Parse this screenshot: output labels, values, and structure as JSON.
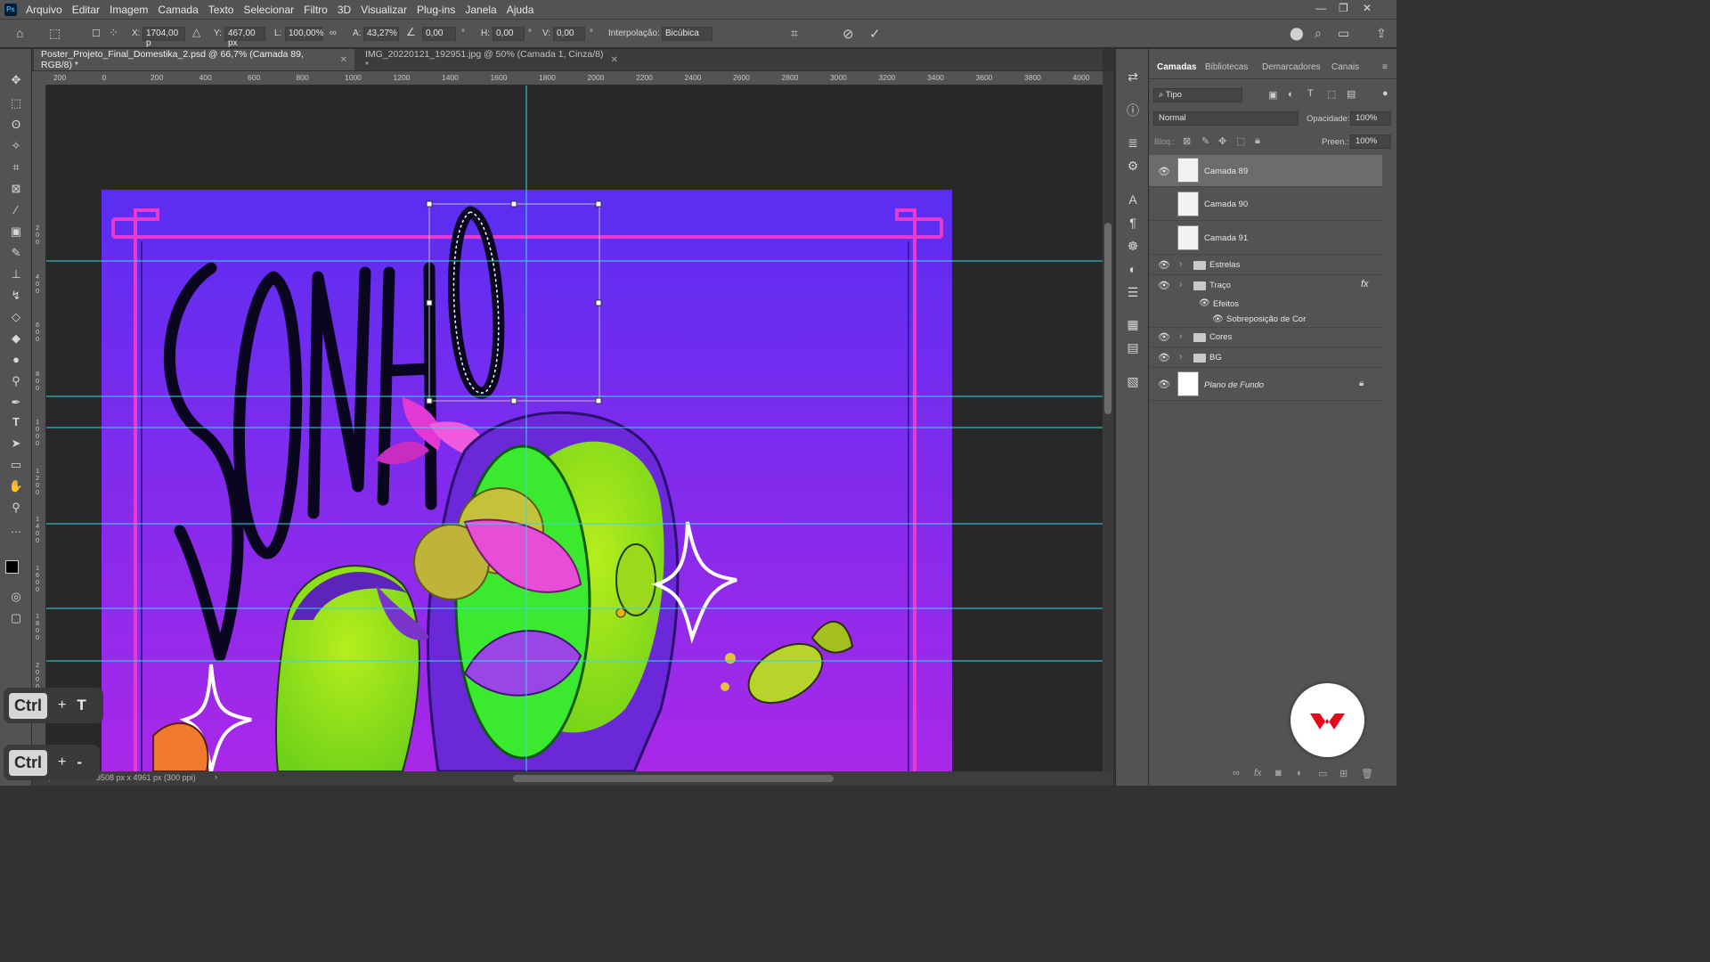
{
  "app": {
    "logo": "Ps"
  },
  "menu": [
    "Arquivo",
    "Editar",
    "Imagem",
    "Camada",
    "Texto",
    "Selecionar",
    "Filtro",
    "3D",
    "Visualizar",
    "Plug-ins",
    "Janela",
    "Ajuda"
  ],
  "options": {
    "x_label": "X:",
    "x_value": "1704,00 p",
    "y_label": "Y:",
    "y_value": "467,00 px",
    "l_label": "L:",
    "l_value": "100,00%",
    "a_label": "A:",
    "a_value": "43,27%",
    "angle_value": "0,00",
    "h_label": "H:",
    "h_value": "0,00",
    "v_label": "V:",
    "v_value": "0,00",
    "interp_label": "Interpolação:",
    "interp_value": "Bicúbica",
    "deg": "°"
  },
  "tabs": [
    {
      "label": "Poster_Projeto_Final_Domestika_2.psd @ 66,7% (Camada 89, RGB/8) *",
      "active": true
    },
    {
      "label": "IMG_20220121_192951.jpg @ 50% (Camada 1, Cinza/8) *",
      "active": false
    }
  ],
  "ruler_ticks": [
    "200",
    "0",
    "200",
    "400",
    "600",
    "800",
    "1000",
    "1200",
    "1400",
    "1600",
    "1800",
    "2000",
    "2200",
    "2400",
    "2600",
    "2800",
    "3000",
    "3200",
    "3400",
    "3600",
    "3800",
    "4000"
  ],
  "ruler_left": [
    "2\n0\n0",
    "4\n0\n0",
    "6\n0\n0",
    "8\n0\n0",
    "1\n0\n0\n0",
    "1\n2\n0\n0",
    "1\n4\n0\n0",
    "1\n6\n0\n0",
    "1\n8\n0\n0",
    "2\n0\n0\n0"
  ],
  "status": {
    "zoom": "66,67%",
    "doc_size": "3508 px x 4961 px (300 ppi)"
  },
  "poster": {
    "title_text": "SONHO",
    "bg_top": "#5a2ef2",
    "bg_bottom": "#a928e8",
    "frame_color": "#e93ad0"
  },
  "panel": {
    "tabs": [
      "Camadas",
      "Bibliotecas",
      "Demarcadores",
      "Canais"
    ],
    "filter_value": "Tipo",
    "blend_mode": "Normal",
    "opacity_label": "Opacidade:",
    "opacity_value": "100%",
    "lock_label": "Bloq.:",
    "fill_label": "Preen.:",
    "fill_value": "100%",
    "layers": [
      {
        "name": "Camada 89",
        "kind": "pixel",
        "visible": true,
        "selected": true
      },
      {
        "name": "Camada 90",
        "kind": "pixel",
        "visible": false,
        "selected": false
      },
      {
        "name": "Camada 91",
        "kind": "pixel",
        "visible": false,
        "selected": false
      },
      {
        "name": "Estrelas",
        "kind": "group",
        "visible": true,
        "selected": false
      },
      {
        "name": "Traço",
        "kind": "group",
        "visible": true,
        "selected": false,
        "fx": "fx"
      },
      {
        "name": "Efeitos",
        "kind": "effects",
        "visible": true,
        "selected": false
      },
      {
        "name": "Sobreposição de Cor",
        "kind": "effect",
        "visible": true,
        "selected": false
      },
      {
        "name": "Cores",
        "kind": "group",
        "visible": true,
        "selected": false
      },
      {
        "name": "BG",
        "kind": "group",
        "visible": true,
        "selected": false
      },
      {
        "name": "Plano de Fundo",
        "kind": "background",
        "visible": true,
        "selected": false
      }
    ]
  },
  "shortcuts": [
    {
      "key": "Ctrl",
      "plus": "+",
      "second": "T"
    },
    {
      "key": "Ctrl",
      "plus": "+",
      "second": "-"
    }
  ],
  "colors": {
    "guide": "#3ad7e6",
    "accent_red": "#e3081c"
  }
}
